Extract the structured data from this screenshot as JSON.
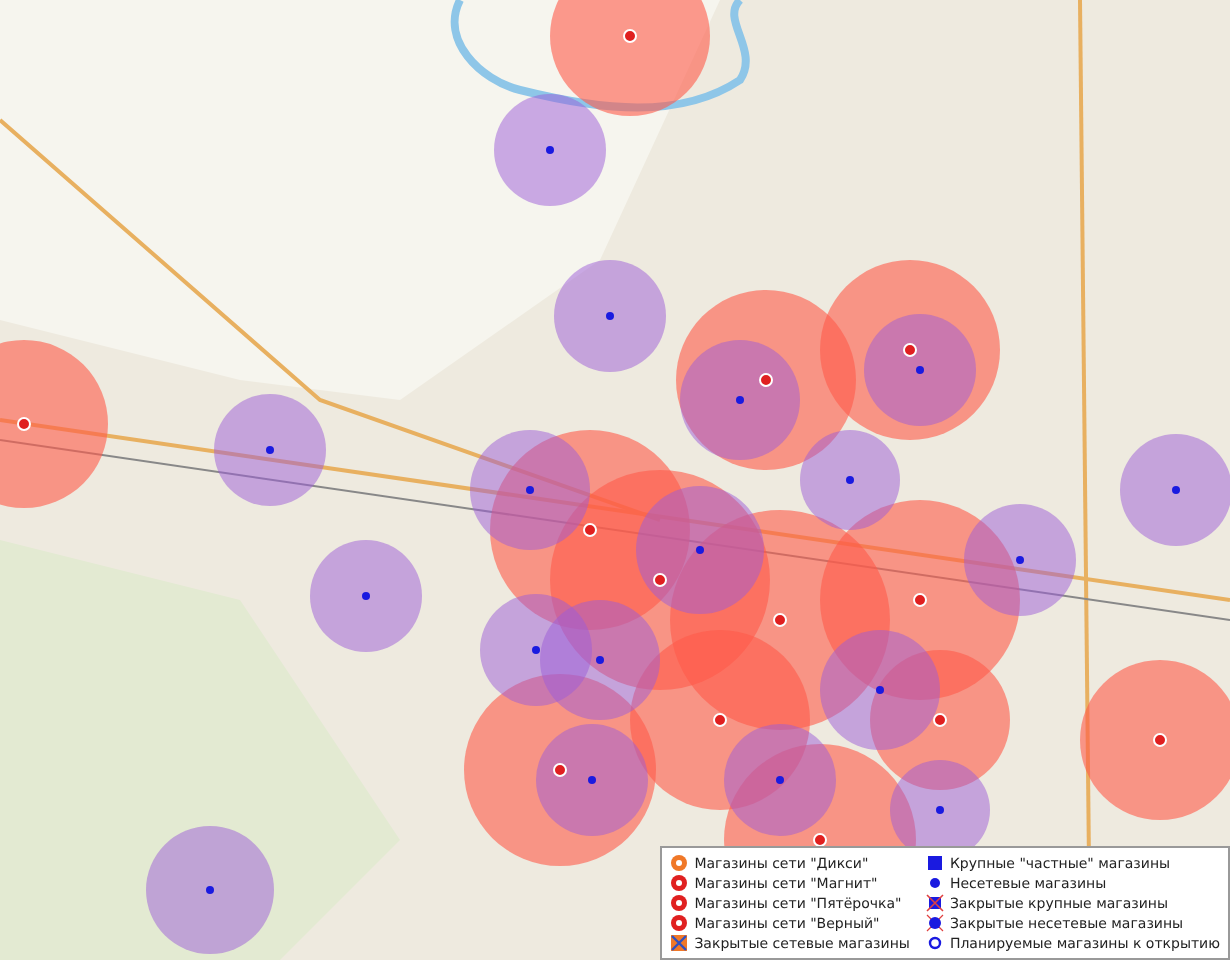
{
  "legend": {
    "items": [
      {
        "kind": "chain",
        "color": "#f07828",
        "label": "Магазины сети \"Дикси\""
      },
      {
        "kind": "chain",
        "color": "#e02020",
        "label": "Магазины сети \"Магнит\""
      },
      {
        "kind": "chain",
        "color": "#e02020",
        "label": "Магазины сети \"Пятёрочка\""
      },
      {
        "kind": "chain",
        "color": "#e02020",
        "label": "Магазины сети \"Верный\""
      },
      {
        "kind": "closed-chain",
        "color": "#f07828",
        "label": "Закрытые сетевые магазины"
      },
      {
        "kind": "large",
        "color": "#1a1ae0",
        "label": "Крупные \"частные\" магазины"
      },
      {
        "kind": "small",
        "color": "#1a1ae0",
        "label": "Несетевые магазины"
      },
      {
        "kind": "closed-large",
        "color": "#1a1ae0",
        "label": "Закрытые крупные магазины"
      },
      {
        "kind": "closed-small",
        "color": "#1a1ae0",
        "label": "Закрытые несетевые магазины"
      },
      {
        "kind": "planned",
        "color": "#1a1ae0",
        "label": "Планируемые магазины к открытию"
      }
    ]
  }
}
